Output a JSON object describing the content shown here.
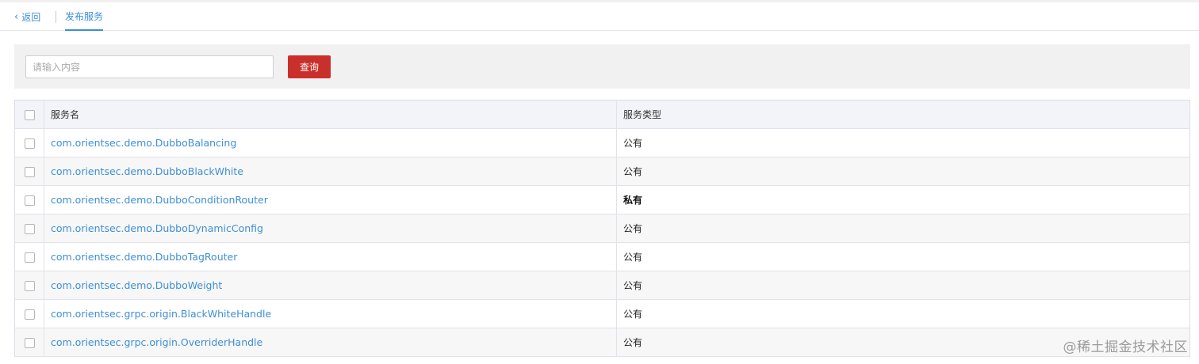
{
  "header": {
    "back_label": "返回",
    "back_icon": "chevron-left-icon",
    "active_tab": "发布服务"
  },
  "search": {
    "placeholder": "请输入内容",
    "value": "",
    "button_label": "查询"
  },
  "table": {
    "columns": [
      "服务名",
      "服务类型"
    ],
    "rows": [
      {
        "name": "com.orientsec.demo.DubboBalancing",
        "type": "公有"
      },
      {
        "name": "com.orientsec.demo.DubboBlackWhite",
        "type": "公有"
      },
      {
        "name": "com.orientsec.demo.DubboConditionRouter",
        "type": "私有"
      },
      {
        "name": "com.orientsec.demo.DubboDynamicConfig",
        "type": "公有"
      },
      {
        "name": "com.orientsec.demo.DubboTagRouter",
        "type": "公有"
      },
      {
        "name": "com.orientsec.demo.DubboWeight",
        "type": "公有"
      },
      {
        "name": "com.orientsec.grpc.origin.BlackWhiteHandle",
        "type": "公有"
      },
      {
        "name": "com.orientsec.grpc.origin.OverriderHandle",
        "type": "公有"
      }
    ]
  },
  "watermark": "@稀土掘金技术社区",
  "colors": {
    "link": "#3d8fd6",
    "primary_button": "#c9302c",
    "search_bg": "#f1f1f1",
    "table_header_bg": "#f3f4fa"
  }
}
